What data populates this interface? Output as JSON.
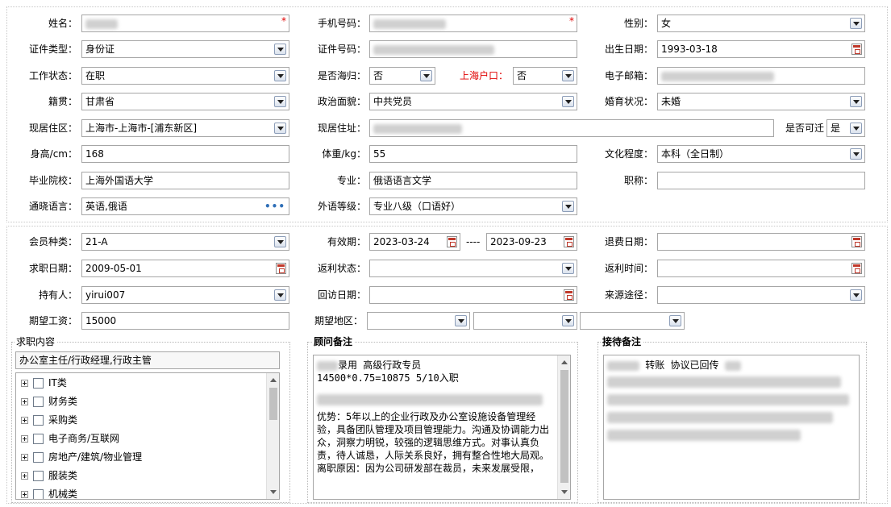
{
  "labels": {
    "name": "姓名：",
    "phone": "手机号码：",
    "gender": "性别：",
    "id_type": "证件类型：",
    "id_no": "证件号码：",
    "birth": "出生日期：",
    "work_status": "工作状态：",
    "returnee": "是否海归：",
    "shanghai_hukou": "上海户口：",
    "email": "电子邮箱：",
    "native": "籍贯：",
    "politics": "政治面貌：",
    "marital": "婚育状况：",
    "residence_area": "现居住区：",
    "address": "现居住址：",
    "relocate": "是否可迁",
    "height": "身高/cm：",
    "weight": "体重/kg：",
    "education": "文化程度：",
    "school": "毕业院校：",
    "major": "专业：",
    "title": "职称：",
    "languages": "通晓语言：",
    "lang_level": "外语等级：",
    "member_type": "会员种类：",
    "validity": "有效期：",
    "refund_date": "退费日期：",
    "job_date": "求职日期：",
    "rebate_status": "返利状态：",
    "rebate_time": "返利时间：",
    "holder": "持有人：",
    "visit_date": "回访日期：",
    "source": "来源途径：",
    "salary": "期望工资：",
    "region": "期望地区："
  },
  "values": {
    "gender": "女",
    "id_type": "身份证",
    "birth": "1993-03-18",
    "work_status": "在职",
    "returnee": "否",
    "shanghai_hukou": "否",
    "native": "甘肃省",
    "politics": "中共党员",
    "marital": "未婚",
    "residence_area": "上海市-上海市-[浦东新区]",
    "relocate": "是",
    "height": "168",
    "weight": "55",
    "education": "本科（全日制）",
    "school": "上海外国语大学",
    "major": "俄语语言文学",
    "title": "",
    "languages": "英语,俄语",
    "lang_level": "专业八级（口语好）",
    "member_type": "21-A",
    "validity_from": "2023-03-24",
    "validity_sep": "----",
    "validity_to": "2023-09-23",
    "refund_date": "",
    "job_date": "2009-05-01",
    "rebate_status": "",
    "rebate_time": "",
    "holder": "yirui007",
    "visit_date": "",
    "source": "",
    "salary": "15000",
    "region1": "",
    "region2": "",
    "region3": ""
  },
  "job_intent": {
    "title": "求职内容",
    "selected": "办公室主任/行政经理,行政主管",
    "tree": [
      "IT类",
      "财务类",
      "采购类",
      "电子商务/互联网",
      "房地产/建筑/物业管理",
      "服装类",
      "机械类"
    ]
  },
  "consultant_note": {
    "title": "顾问备注",
    "line1": "录用 高级行政专员",
    "line2": "14500*0.75=10875  5/10入职",
    "body": "优势：5年以上的企业行政及办公室设施设备管理经验，具备团队管理及项目管理能力。沟通及协调能力出众，洞察力明锐，较强的逻辑思维方式。对事认真负责，待人诚恳，人际关系良好，拥有整合性地大局观。",
    "tail": "离职原因：因为公司研发部在裁员，未来发展受限，"
  },
  "reception_note": {
    "title": "接待备注",
    "line1": "转账 协议已回传"
  },
  "icons": {
    "select": "chevron-down-icon",
    "calendar": "calendar-icon",
    "more": "ellipsis-icon"
  }
}
